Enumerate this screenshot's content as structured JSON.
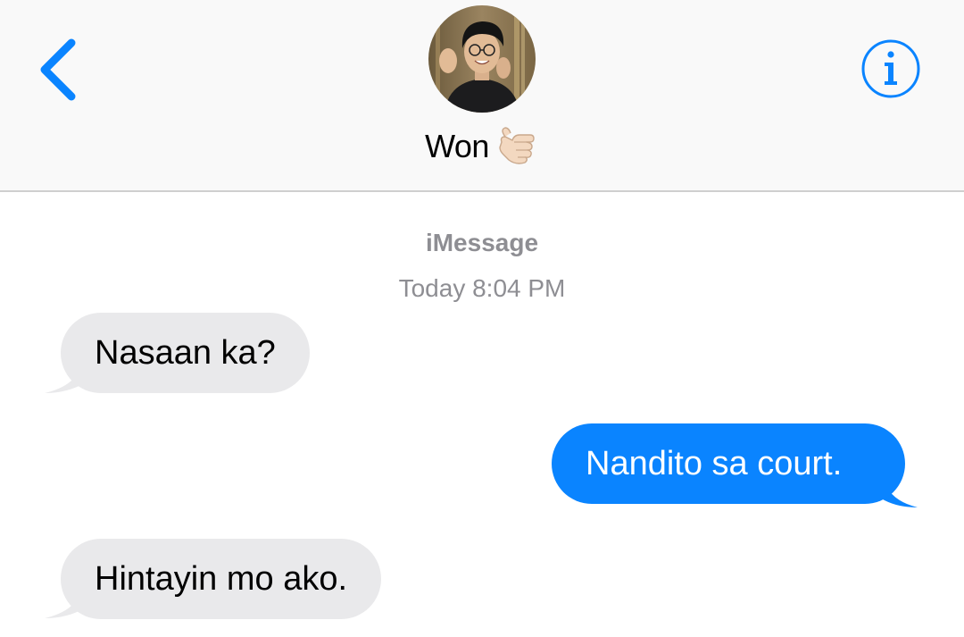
{
  "header": {
    "contact_name": "Won",
    "contact_emoji": "🤙🏻",
    "back_icon": "chevron-left-icon",
    "info_icon": "info-circle-icon",
    "accent_color": "#0a84ff"
  },
  "conversation": {
    "service_label": "iMessage",
    "timestamp": "Today 8:04 PM",
    "messages": [
      {
        "direction": "incoming",
        "text": "Nasaan ka?"
      },
      {
        "direction": "outgoing",
        "text": "Nandito sa court."
      },
      {
        "direction": "incoming",
        "text": "Hintayin mo ako."
      }
    ]
  },
  "colors": {
    "incoming_bubble": "#e9e9eb",
    "outgoing_bubble": "#0a84ff",
    "meta_text": "#8e8e93",
    "header_bg": "#f9f9f9"
  }
}
